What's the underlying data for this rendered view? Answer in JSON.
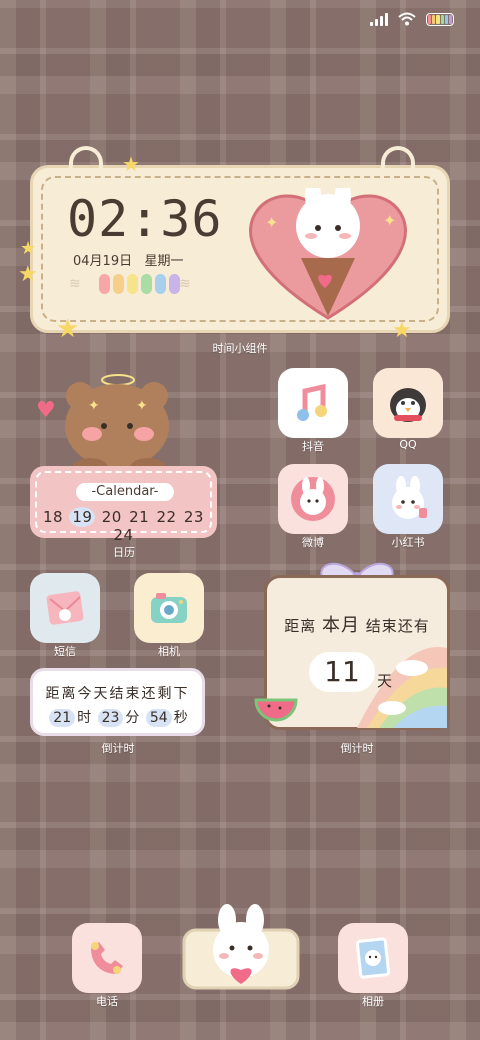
{
  "status_bar": {
    "signal_icon": "signal-icon",
    "wifi_icon": "wifi-icon",
    "battery_icon": "battery-icon"
  },
  "clock_widget": {
    "time": "02:36",
    "date": "04月19日",
    "weekday": "星期一",
    "label": "时间小组件"
  },
  "calendar_widget": {
    "header": "-Calendar-",
    "days": [
      "18",
      "19",
      "20",
      "21",
      "22",
      "23",
      "24"
    ],
    "today": "19",
    "label": "日历"
  },
  "apps": {
    "douyin": {
      "label": "抖音",
      "icon": "music-note-icon"
    },
    "qq": {
      "label": "QQ",
      "icon": "penguin-icon"
    },
    "weibo": {
      "label": "微博",
      "icon": "bunny-icon"
    },
    "xiaohongshu": {
      "label": "小红书",
      "icon": "bunny-icon"
    },
    "messages": {
      "label": "短信",
      "icon": "envelope-icon"
    },
    "camera": {
      "label": "相机",
      "icon": "camera-icon"
    },
    "phone": {
      "label": "电话",
      "icon": "phone-icon"
    },
    "gallery": {
      "label": "相册",
      "icon": "photo-icon"
    }
  },
  "day_timer": {
    "line1": "距离今天结束还剩下",
    "hours": "21",
    "hours_unit": "时",
    "minutes": "23",
    "minutes_unit": "分",
    "seconds": "54",
    "seconds_unit": "秒",
    "label": "倒计时"
  },
  "month_countdown": {
    "prefix": "距离",
    "highlight": "本月",
    "suffix": "结束还有",
    "days": "11",
    "unit": "天",
    "label": "倒计时"
  },
  "colors": {
    "accent_pink": "#f2c4c3",
    "accent_blue": "#d7e3f5",
    "cream": "#f7ecd5"
  }
}
